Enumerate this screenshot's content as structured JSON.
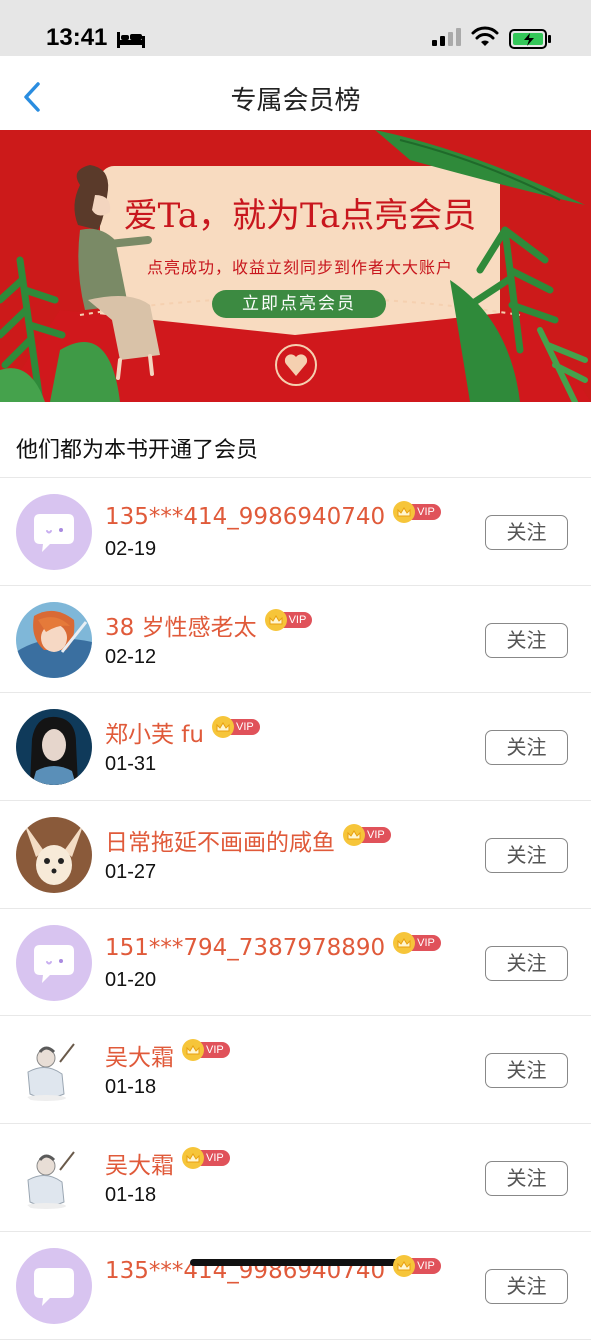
{
  "status": {
    "time": "13:41"
  },
  "nav": {
    "title": "专属会员榜"
  },
  "banner": {
    "title": "爱Ta，就为Ta点亮会员",
    "subtitle": "点亮成功，收益立刻同步到作者大大账户",
    "button": "立即点亮会员"
  },
  "section": {
    "header": "他们都为本书开通了会员"
  },
  "vip_label": "VIP",
  "follow_label": "关注",
  "members": [
    {
      "name": "135***414_9986940740",
      "date": "02-19",
      "avatar": "default-bubble"
    },
    {
      "name": "38 岁性感老太",
      "date": "02-12",
      "avatar": "anime"
    },
    {
      "name": "郑小芙 fu",
      "date": "01-31",
      "avatar": "portrait"
    },
    {
      "name": "日常拖延不画画的咸鱼",
      "date": "01-27",
      "avatar": "fox"
    },
    {
      "name": "151***794_7387978890",
      "date": "01-20",
      "avatar": "default-bubble"
    },
    {
      "name": "吴大霜",
      "date": "01-18",
      "avatar": "sketch"
    },
    {
      "name": "吴大霜",
      "date": "01-18",
      "avatar": "sketch"
    },
    {
      "name": "135***414_9986940740",
      "date": "",
      "avatar": "default-bubble"
    }
  ]
}
